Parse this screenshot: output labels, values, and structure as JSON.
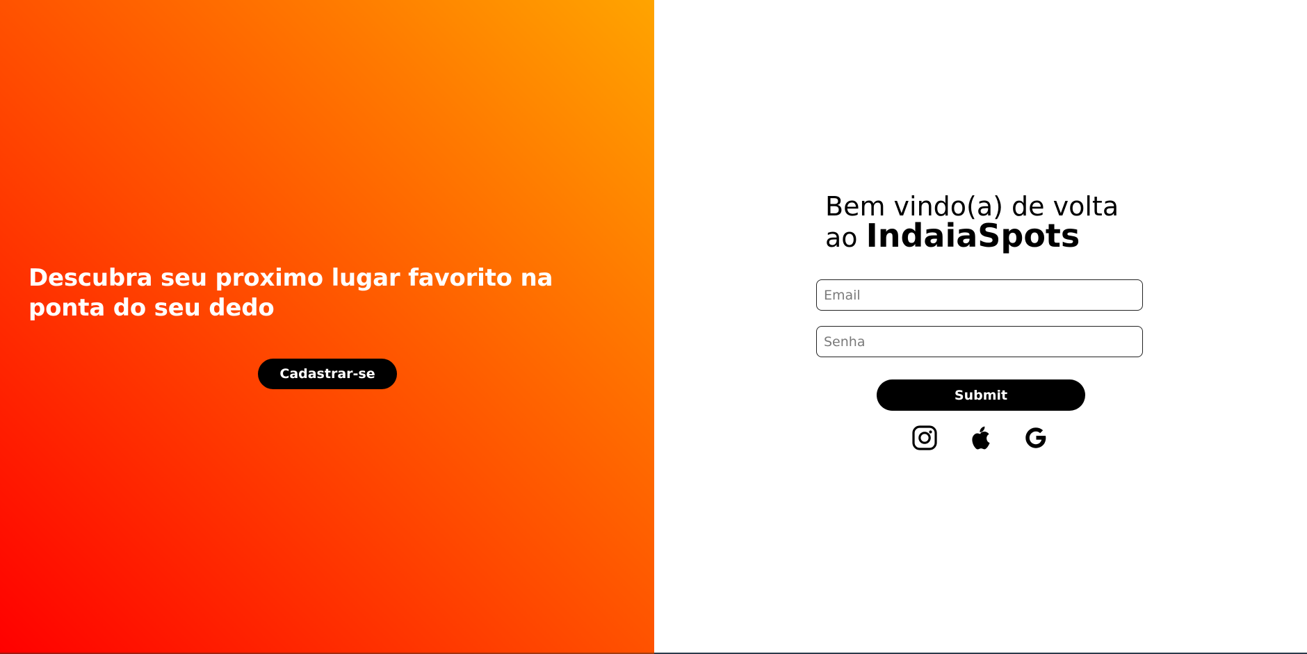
{
  "left_panel": {
    "tagline": "Descubra seu proximo lugar favorito na ponta do seu dedo",
    "signup_label": "Cadastrar-se",
    "gradient_colors": [
      "#ff0000",
      "#ff4a00",
      "#ff7a00",
      "#ffa400"
    ]
  },
  "login": {
    "welcome_line1": "Bem vindo(a) de volta",
    "welcome_prefix": "ao ",
    "brand": "IndaiaSpots",
    "email_placeholder": "Email",
    "email_value": "",
    "password_placeholder": "Senha",
    "password_value": "",
    "submit_label": "Submit"
  },
  "social": [
    {
      "icon": "instagram-icon"
    },
    {
      "icon": "apple-icon"
    },
    {
      "icon": "google-icon"
    }
  ]
}
